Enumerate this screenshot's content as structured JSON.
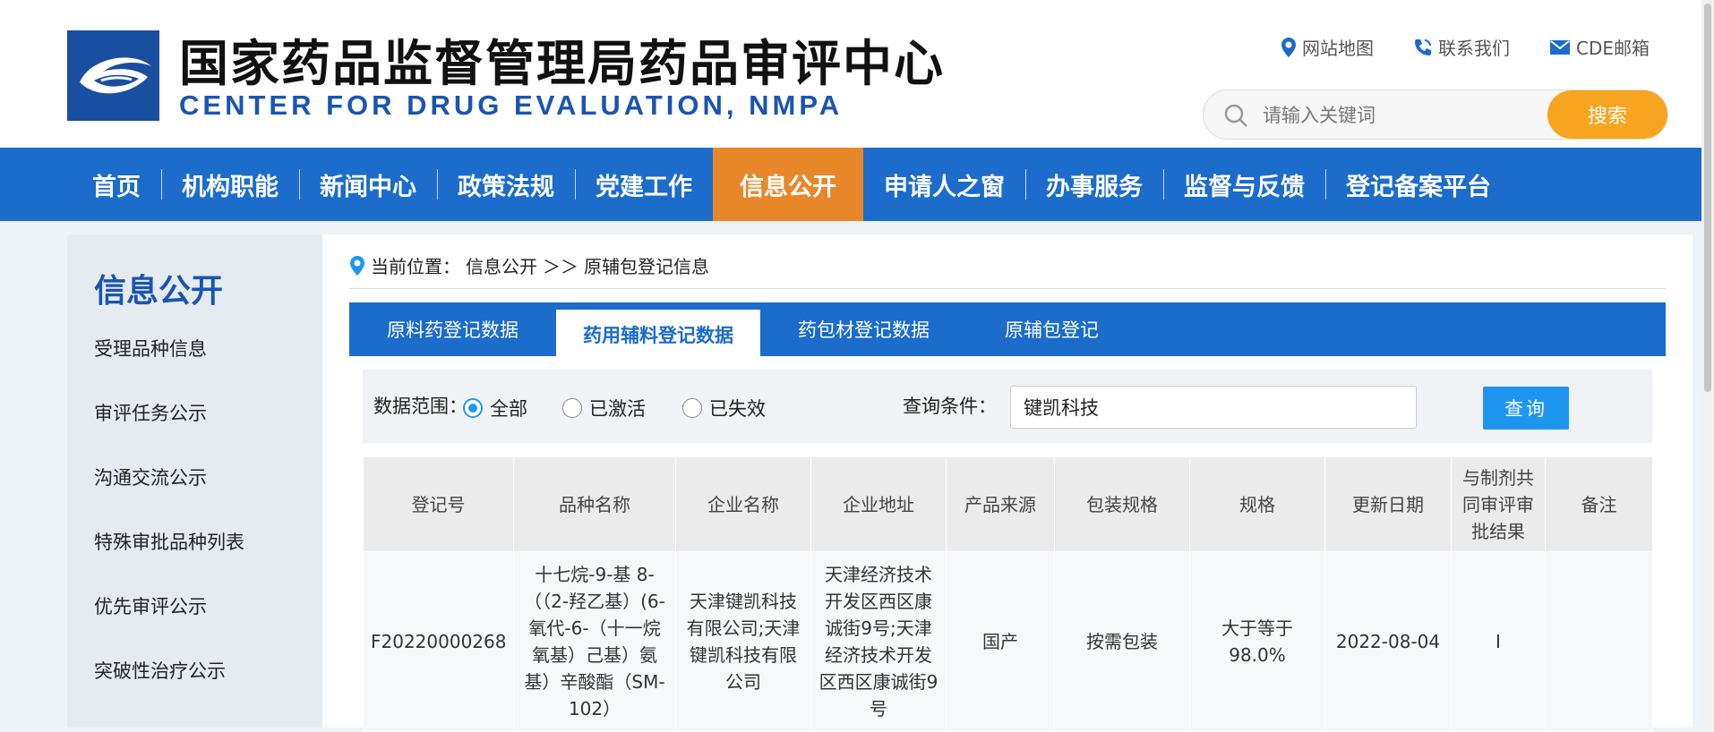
{
  "header": {
    "title_cn": "国家药品监督管理局药品审评中心",
    "title_en": "CENTER FOR DRUG EVALUATION, NMPA",
    "links": [
      {
        "label": "网站地图",
        "icon": "location-pin-icon"
      },
      {
        "label": "联系我们",
        "icon": "phone-icon"
      },
      {
        "label": "CDE邮箱",
        "icon": "mail-icon"
      }
    ],
    "search": {
      "placeholder": "请输入关键词",
      "button": "搜索"
    }
  },
  "nav": {
    "items": [
      "首页",
      "机构职能",
      "新闻中心",
      "政策法规",
      "党建工作",
      "信息公开",
      "申请人之窗",
      "办事服务",
      "监督与反馈",
      "登记备案平台"
    ],
    "active_index": 5,
    "colors": {
      "bar": "#1b6ccb",
      "active": "#e8872a"
    }
  },
  "sidebar": {
    "title": "信息公开",
    "items": [
      "受理品种信息",
      "审评任务公示",
      "沟通交流公示",
      "特殊审批品种列表",
      "优先审评公示",
      "突破性治疗公示"
    ]
  },
  "breadcrumb": {
    "prefix": "当前位置：",
    "section": "信息公开",
    "separator": "＞＞",
    "page": "原辅包登记信息"
  },
  "tabs": {
    "items": [
      "原料药登记数据",
      "药用辅料登记数据",
      "药包材登记数据",
      "原辅包登记"
    ],
    "active_index": 1
  },
  "filter": {
    "range_label": "数据范围：",
    "options": [
      "全部",
      "已激活",
      "已失效"
    ],
    "selected_index": 0,
    "query_label": "查询条件：",
    "query_value": "键凯科技",
    "query_button": "查询"
  },
  "table": {
    "headers": [
      "登记号",
      "品种名称",
      "企业名称",
      "企业地址",
      "产品来源",
      "包装规格",
      "规格",
      "更新日期",
      "与制剂共同审评审批结果",
      "备注"
    ],
    "rows": [
      [
        "F20220000268",
        "十七烷-9-基 8-（（2-羟乙基）(6-氧代-6-（十一烷氧基）己基）氨基）辛酸酯（SM-102）",
        "天津键凯科技有限公司;天津键凯科技有限公司",
        "天津经济技术开发区西区康诚街9号;天津经济技术开发区西区康诚街9号",
        "国产",
        "按需包装",
        "大于等于98.0%",
        "2022-08-04",
        "I",
        ""
      ]
    ]
  }
}
